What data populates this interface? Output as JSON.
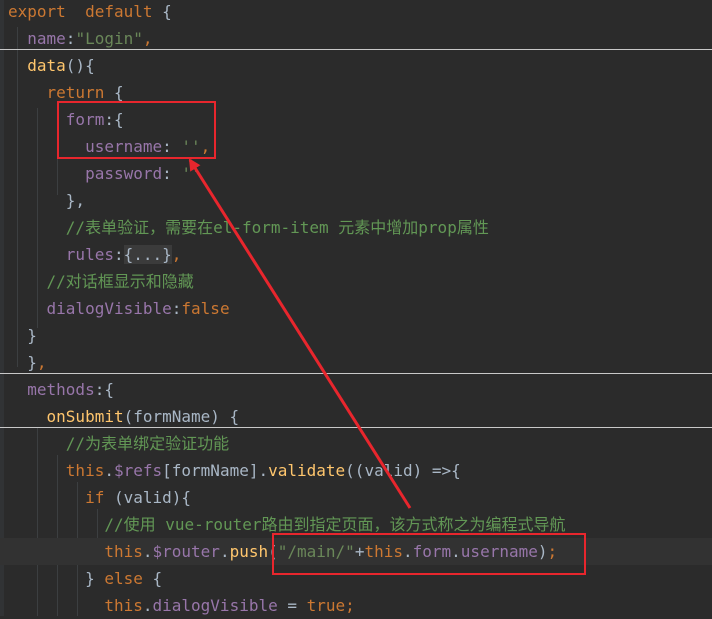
{
  "lines": [
    {
      "tokens": [
        {
          "c": "kw",
          "t": "export"
        },
        {
          "c": "plain",
          "t": "  "
        },
        {
          "c": "kw",
          "t": "default"
        },
        {
          "c": "plain",
          "t": " {"
        }
      ]
    },
    {
      "tokens": [
        {
          "c": "plain",
          "t": "  "
        },
        {
          "c": "prop",
          "t": "name"
        },
        {
          "c": "plain",
          "t": ":"
        },
        {
          "c": "str",
          "t": "\"Login\""
        },
        {
          "c": "kw",
          "t": ","
        }
      ]
    },
    {
      "tokens": [
        {
          "c": "plain",
          "t": "  "
        },
        {
          "c": "fn",
          "t": "data"
        },
        {
          "c": "plain",
          "t": "(){"
        }
      ]
    },
    {
      "tokens": [
        {
          "c": "plain",
          "t": "    "
        },
        {
          "c": "kw",
          "t": "return"
        },
        {
          "c": "plain",
          "t": " {"
        }
      ]
    },
    {
      "tokens": [
        {
          "c": "plain",
          "t": "      "
        },
        {
          "c": "prop",
          "t": "form"
        },
        {
          "c": "plain",
          "t": ":{"
        }
      ]
    },
    {
      "tokens": [
        {
          "c": "plain",
          "t": "        "
        },
        {
          "c": "prop",
          "t": "username"
        },
        {
          "c": "plain",
          "t": ": "
        },
        {
          "c": "str",
          "t": "''"
        },
        {
          "c": "kw",
          "t": ","
        }
      ]
    },
    {
      "tokens": [
        {
          "c": "plain",
          "t": "        "
        },
        {
          "c": "prop",
          "t": "password"
        },
        {
          "c": "plain",
          "t": ": "
        },
        {
          "c": "str",
          "t": "''"
        }
      ]
    },
    {
      "tokens": [
        {
          "c": "plain",
          "t": "      },"
        }
      ]
    },
    {
      "tokens": [
        {
          "c": "plain",
          "t": "      "
        },
        {
          "c": "cmt",
          "t": "//表单验证，需要在el-form-item 元素中增加prop属性"
        }
      ]
    },
    {
      "tokens": [
        {
          "c": "plain",
          "t": "      "
        },
        {
          "c": "prop",
          "t": "rules"
        },
        {
          "c": "plain",
          "t": ":"
        },
        {
          "c": "fold",
          "t": "{...}"
        },
        {
          "c": "kw",
          "t": ","
        }
      ]
    },
    {
      "tokens": [
        {
          "c": "plain",
          "t": "    "
        },
        {
          "c": "cmt",
          "t": "//对话框显示和隐藏"
        }
      ]
    },
    {
      "tokens": [
        {
          "c": "plain",
          "t": "    "
        },
        {
          "c": "prop",
          "t": "dialogVisible"
        },
        {
          "c": "plain",
          "t": ":"
        },
        {
          "c": "kw",
          "t": "false"
        }
      ]
    },
    {
      "tokens": [
        {
          "c": "plain",
          "t": "  }"
        }
      ]
    },
    {
      "tokens": [
        {
          "c": "plain",
          "t": "  }"
        },
        {
          "c": "kw",
          "t": ","
        }
      ]
    },
    {
      "tokens": [
        {
          "c": "plain",
          "t": "  "
        },
        {
          "c": "prop",
          "t": "methods"
        },
        {
          "c": "plain",
          "t": ":{"
        }
      ]
    },
    {
      "tokens": [
        {
          "c": "plain",
          "t": "    "
        },
        {
          "c": "fn",
          "t": "onSubmit"
        },
        {
          "c": "plain",
          "t": "(formName) {"
        }
      ]
    },
    {
      "tokens": [
        {
          "c": "plain",
          "t": "      "
        },
        {
          "c": "cmt",
          "t": "//为表单绑定验证功能"
        }
      ]
    },
    {
      "tokens": [
        {
          "c": "plain",
          "t": "      "
        },
        {
          "c": "kw",
          "t": "this"
        },
        {
          "c": "plain",
          "t": "."
        },
        {
          "c": "prop",
          "t": "$refs"
        },
        {
          "c": "plain",
          "t": "[formName]."
        },
        {
          "c": "fn",
          "t": "validate"
        },
        {
          "c": "plain",
          "t": "((valid) =>{"
        }
      ]
    },
    {
      "tokens": [
        {
          "c": "plain",
          "t": "        "
        },
        {
          "c": "kw",
          "t": "if"
        },
        {
          "c": "plain",
          "t": " (valid){"
        }
      ]
    },
    {
      "tokens": [
        {
          "c": "plain",
          "t": "          "
        },
        {
          "c": "cmt",
          "t": "//使用 vue-router路由到指定页面，该方式称之为编程式导航"
        }
      ]
    },
    {
      "tokens": [
        {
          "c": "plain",
          "t": "          "
        },
        {
          "c": "kw",
          "t": "this"
        },
        {
          "c": "plain",
          "t": "."
        },
        {
          "c": "prop",
          "t": "$router"
        },
        {
          "c": "plain",
          "t": "."
        },
        {
          "c": "fn",
          "t": "push"
        },
        {
          "c": "plain",
          "t": "("
        },
        {
          "c": "str",
          "t": "\"/main/\""
        },
        {
          "c": "plain",
          "t": "+"
        },
        {
          "c": "kw",
          "t": "this"
        },
        {
          "c": "plain",
          "t": "."
        },
        {
          "c": "prop",
          "t": "form"
        },
        {
          "c": "plain",
          "t": "."
        },
        {
          "c": "prop",
          "t": "username"
        },
        {
          "c": "plain",
          "t": ")"
        },
        {
          "c": "kw",
          "t": ";"
        }
      ]
    },
    {
      "tokens": [
        {
          "c": "plain",
          "t": "        } "
        },
        {
          "c": "kw",
          "t": "else"
        },
        {
          "c": "plain",
          "t": " {"
        }
      ]
    },
    {
      "tokens": [
        {
          "c": "plain",
          "t": "          "
        },
        {
          "c": "kw",
          "t": "this"
        },
        {
          "c": "plain",
          "t": "."
        },
        {
          "c": "prop",
          "t": "dialogVisible"
        },
        {
          "c": "plain",
          "t": " = "
        },
        {
          "c": "kw",
          "t": "true"
        },
        {
          "c": "kw",
          "t": ";"
        }
      ]
    }
  ],
  "current_line": 20,
  "annotation_color": "#e8262d"
}
